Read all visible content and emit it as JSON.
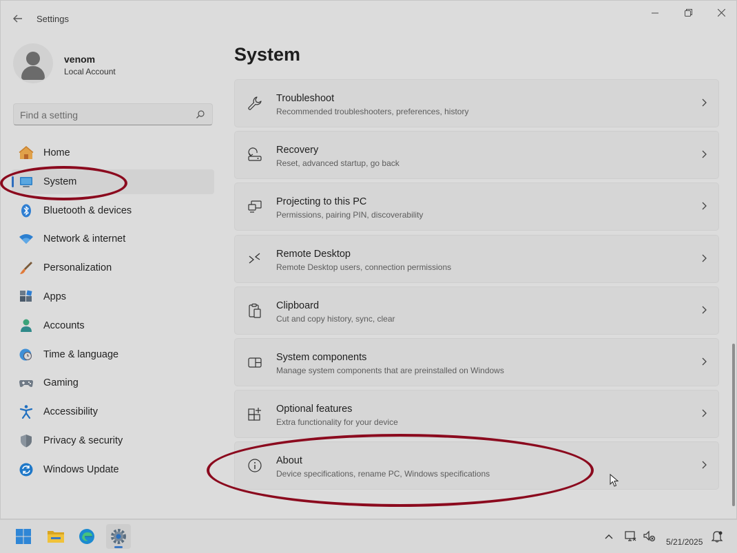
{
  "window": {
    "title": "Settings"
  },
  "user": {
    "name": "venom",
    "account_type": "Local Account"
  },
  "search": {
    "placeholder": "Find a setting"
  },
  "nav": {
    "items": [
      {
        "label": "Home",
        "icon": "home-icon"
      },
      {
        "label": "System",
        "icon": "system-icon",
        "active": true
      },
      {
        "label": "Bluetooth & devices",
        "icon": "bluetooth-icon"
      },
      {
        "label": "Network & internet",
        "icon": "wifi-icon"
      },
      {
        "label": "Personalization",
        "icon": "brush-icon"
      },
      {
        "label": "Apps",
        "icon": "apps-icon"
      },
      {
        "label": "Accounts",
        "icon": "accounts-icon"
      },
      {
        "label": "Time & language",
        "icon": "globe-clock-icon"
      },
      {
        "label": "Gaming",
        "icon": "gamepad-icon"
      },
      {
        "label": "Accessibility",
        "icon": "accessibility-icon"
      },
      {
        "label": "Privacy & security",
        "icon": "shield-icon"
      },
      {
        "label": "Windows Update",
        "icon": "update-icon"
      }
    ]
  },
  "page": {
    "title": "System"
  },
  "cards": [
    {
      "title": "Troubleshoot",
      "desc": "Recommended troubleshooters, preferences, history",
      "icon": "wrench-icon"
    },
    {
      "title": "Recovery",
      "desc": "Reset, advanced startup, go back",
      "icon": "recovery-icon"
    },
    {
      "title": "Projecting to this PC",
      "desc": "Permissions, pairing PIN, discoverability",
      "icon": "projecting-icon"
    },
    {
      "title": "Remote Desktop",
      "desc": "Remote Desktop users, connection permissions",
      "icon": "remote-desktop-icon"
    },
    {
      "title": "Clipboard",
      "desc": "Cut and copy history, sync, clear",
      "icon": "clipboard-icon"
    },
    {
      "title": "System components",
      "desc": "Manage system components that are preinstalled on Windows",
      "icon": "system-components-icon"
    },
    {
      "title": "Optional features",
      "desc": "Extra functionality for your device",
      "icon": "optional-features-icon"
    },
    {
      "title": "About",
      "desc": "Device specifications, rename PC, Windows specifications",
      "icon": "info-icon"
    }
  ],
  "taskbar": {
    "apps": [
      "start-icon",
      "file-explorer-icon",
      "edge-icon",
      "settings-icon"
    ],
    "tray": [
      "chevron-up-icon",
      "network-icon",
      "volume-muted-icon",
      "notification-icon"
    ],
    "date": "5/21/2025"
  },
  "colors": {
    "accent": "#2f6ebd",
    "annotation": "#8b0a1e"
  }
}
